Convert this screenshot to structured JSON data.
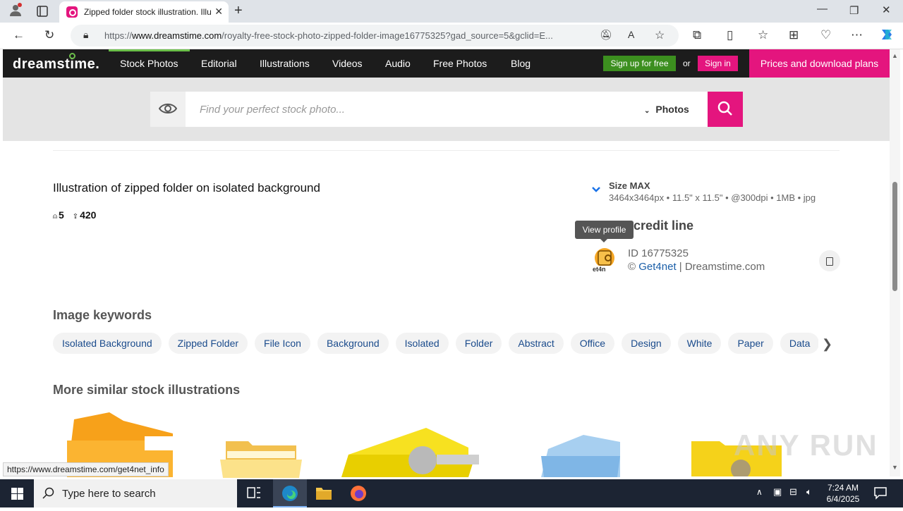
{
  "browser": {
    "tab_title": "Zipped folder stock illustration. Illustration of",
    "url_prefix": "https://",
    "url_domain": "www.dreamstime.com",
    "url_path": "/royalty-free-stock-photo-zipped-folder-image16775325?gad_source=5&gclid=E..."
  },
  "site": {
    "logo": "dreamstime.",
    "nav": [
      "Stock Photos",
      "Editorial",
      "Illustrations",
      "Videos",
      "Audio",
      "Free Photos",
      "Blog"
    ],
    "signup": "Sign up for free",
    "or": "or",
    "signin": "Sign in",
    "prices": "Prices and download plans",
    "search_placeholder": "Find your perfect stock photo...",
    "search_type": "Photos"
  },
  "image": {
    "title": "Illustration of zipped folder on isolated background",
    "stat_a": "5",
    "stat_b": "420",
    "size_label": "Size MAX",
    "size_spec": "3464x3464px • 11.5\" x 11.5\" • @300dpi • 1MB • jpg",
    "credit_heading": "credit line",
    "tooltip": "View profile",
    "id_line": "ID 16775325",
    "copyright_symbol": "©",
    "author": "Get4net",
    "agency": " | Dreamstime.com"
  },
  "keywords": {
    "heading": "Image keywords",
    "items": [
      "Isolated Background",
      "Zipped Folder",
      "File Icon",
      "Background",
      "Isolated",
      "Folder",
      "Abstract",
      "Office",
      "Design",
      "White",
      "Paper",
      "Data"
    ]
  },
  "similar": {
    "heading": "More similar stock illustrations"
  },
  "status_url": "https://www.dreamstime.com/get4net_info",
  "watermark": "ANY RUN",
  "taskbar": {
    "search_placeholder": "Type here to search",
    "time": "7:24 AM",
    "date": "6/4/2025"
  },
  "colors": {
    "brand_pink": "#e4157e",
    "brand_green": "#3c8f1f",
    "header_bg": "#1c1c1c"
  }
}
